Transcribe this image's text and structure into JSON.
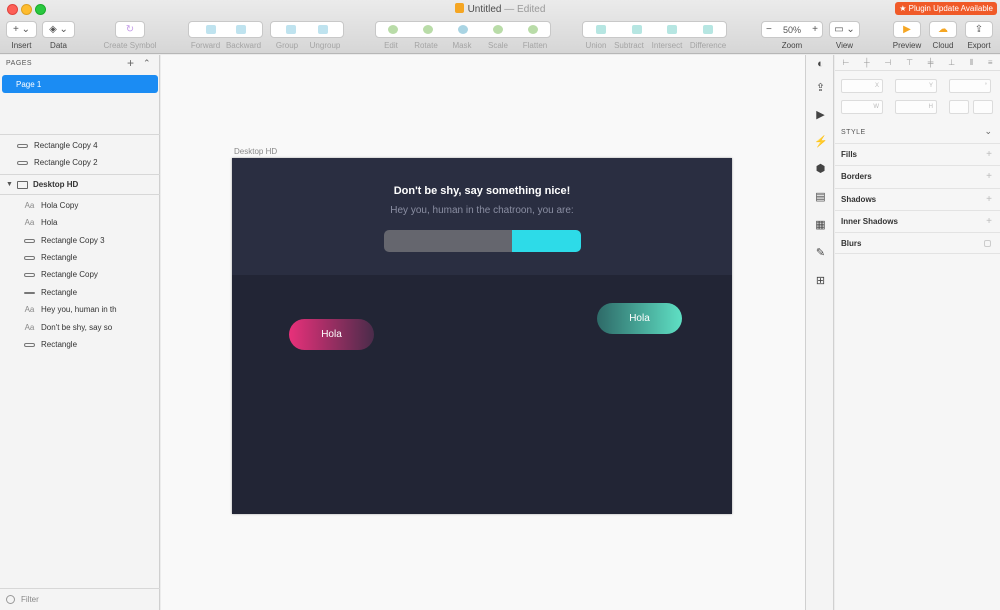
{
  "window": {
    "title": "Untitled",
    "status": "— Edited",
    "plugin_badge": "Plugin Update Available"
  },
  "toolbar": {
    "insert": "Insert",
    "data": "Data",
    "create_symbol": "Create Symbol",
    "forward": "Forward",
    "backward": "Backward",
    "group": "Group",
    "ungroup": "Ungroup",
    "edit": "Edit",
    "rotate": "Rotate",
    "mask": "Mask",
    "scale": "Scale",
    "flatten": "Flatten",
    "union": "Union",
    "subtract": "Subtract",
    "intersect": "Intersect",
    "difference": "Difference",
    "zoom_label": "Zoom",
    "zoom_value": "50%",
    "zoom_minus": "−",
    "zoom_plus": "+",
    "view": "View",
    "preview": "Preview",
    "cloud": "Cloud",
    "export": "Export"
  },
  "sidebar": {
    "pages_header": "PAGES",
    "pages": [
      {
        "label": "Page 1"
      }
    ],
    "layers": [
      {
        "label": "Rectangle Copy 4",
        "kind": "shape"
      },
      {
        "label": "Rectangle Copy 2",
        "kind": "shape"
      },
      {
        "label": "Desktop HD",
        "kind": "artboard"
      },
      {
        "label": "Hola Copy",
        "kind": "text"
      },
      {
        "label": "Hola",
        "kind": "text"
      },
      {
        "label": "Rectangle Copy 3",
        "kind": "shape"
      },
      {
        "label": "Rectangle",
        "kind": "shape"
      },
      {
        "label": "Rectangle Copy",
        "kind": "shape"
      },
      {
        "label": "Rectangle",
        "kind": "line"
      },
      {
        "label": "Hey you, human in th",
        "kind": "text"
      },
      {
        "label": "Don't be shy, say so",
        "kind": "text"
      },
      {
        "label": "Rectangle",
        "kind": "shape"
      }
    ],
    "text_glyph": "Aa",
    "filter": "Filter"
  },
  "canvas": {
    "artboard_label": "Desktop HD",
    "heading": "Don't be shy, say something nice!",
    "subheading": "Hey you, human in the chatroon, you are:",
    "meter_fill": 0.65,
    "pill_left": "Hola",
    "pill_right": "Hola"
  },
  "inspector": {
    "fields": {
      "x": "X",
      "y": "Y",
      "rot": "°",
      "w": "W",
      "h": "H"
    },
    "style_header": "STYLE",
    "sections": [
      {
        "label": "Fills"
      },
      {
        "label": "Borders"
      },
      {
        "label": "Shadows"
      },
      {
        "label": "Inner Shadows"
      },
      {
        "label": "Blurs"
      }
    ]
  },
  "colors": {
    "accent": "#1b8cf3",
    "artboard_bg": "#222535",
    "header_bg": "#2a2e41",
    "meter_grey": "#65666e",
    "meter_cyan": "#2ddbe8",
    "pill_pink": "#e8307a",
    "pill_teal": "#5fe0c4",
    "plugin_badge": "#f05a28"
  }
}
